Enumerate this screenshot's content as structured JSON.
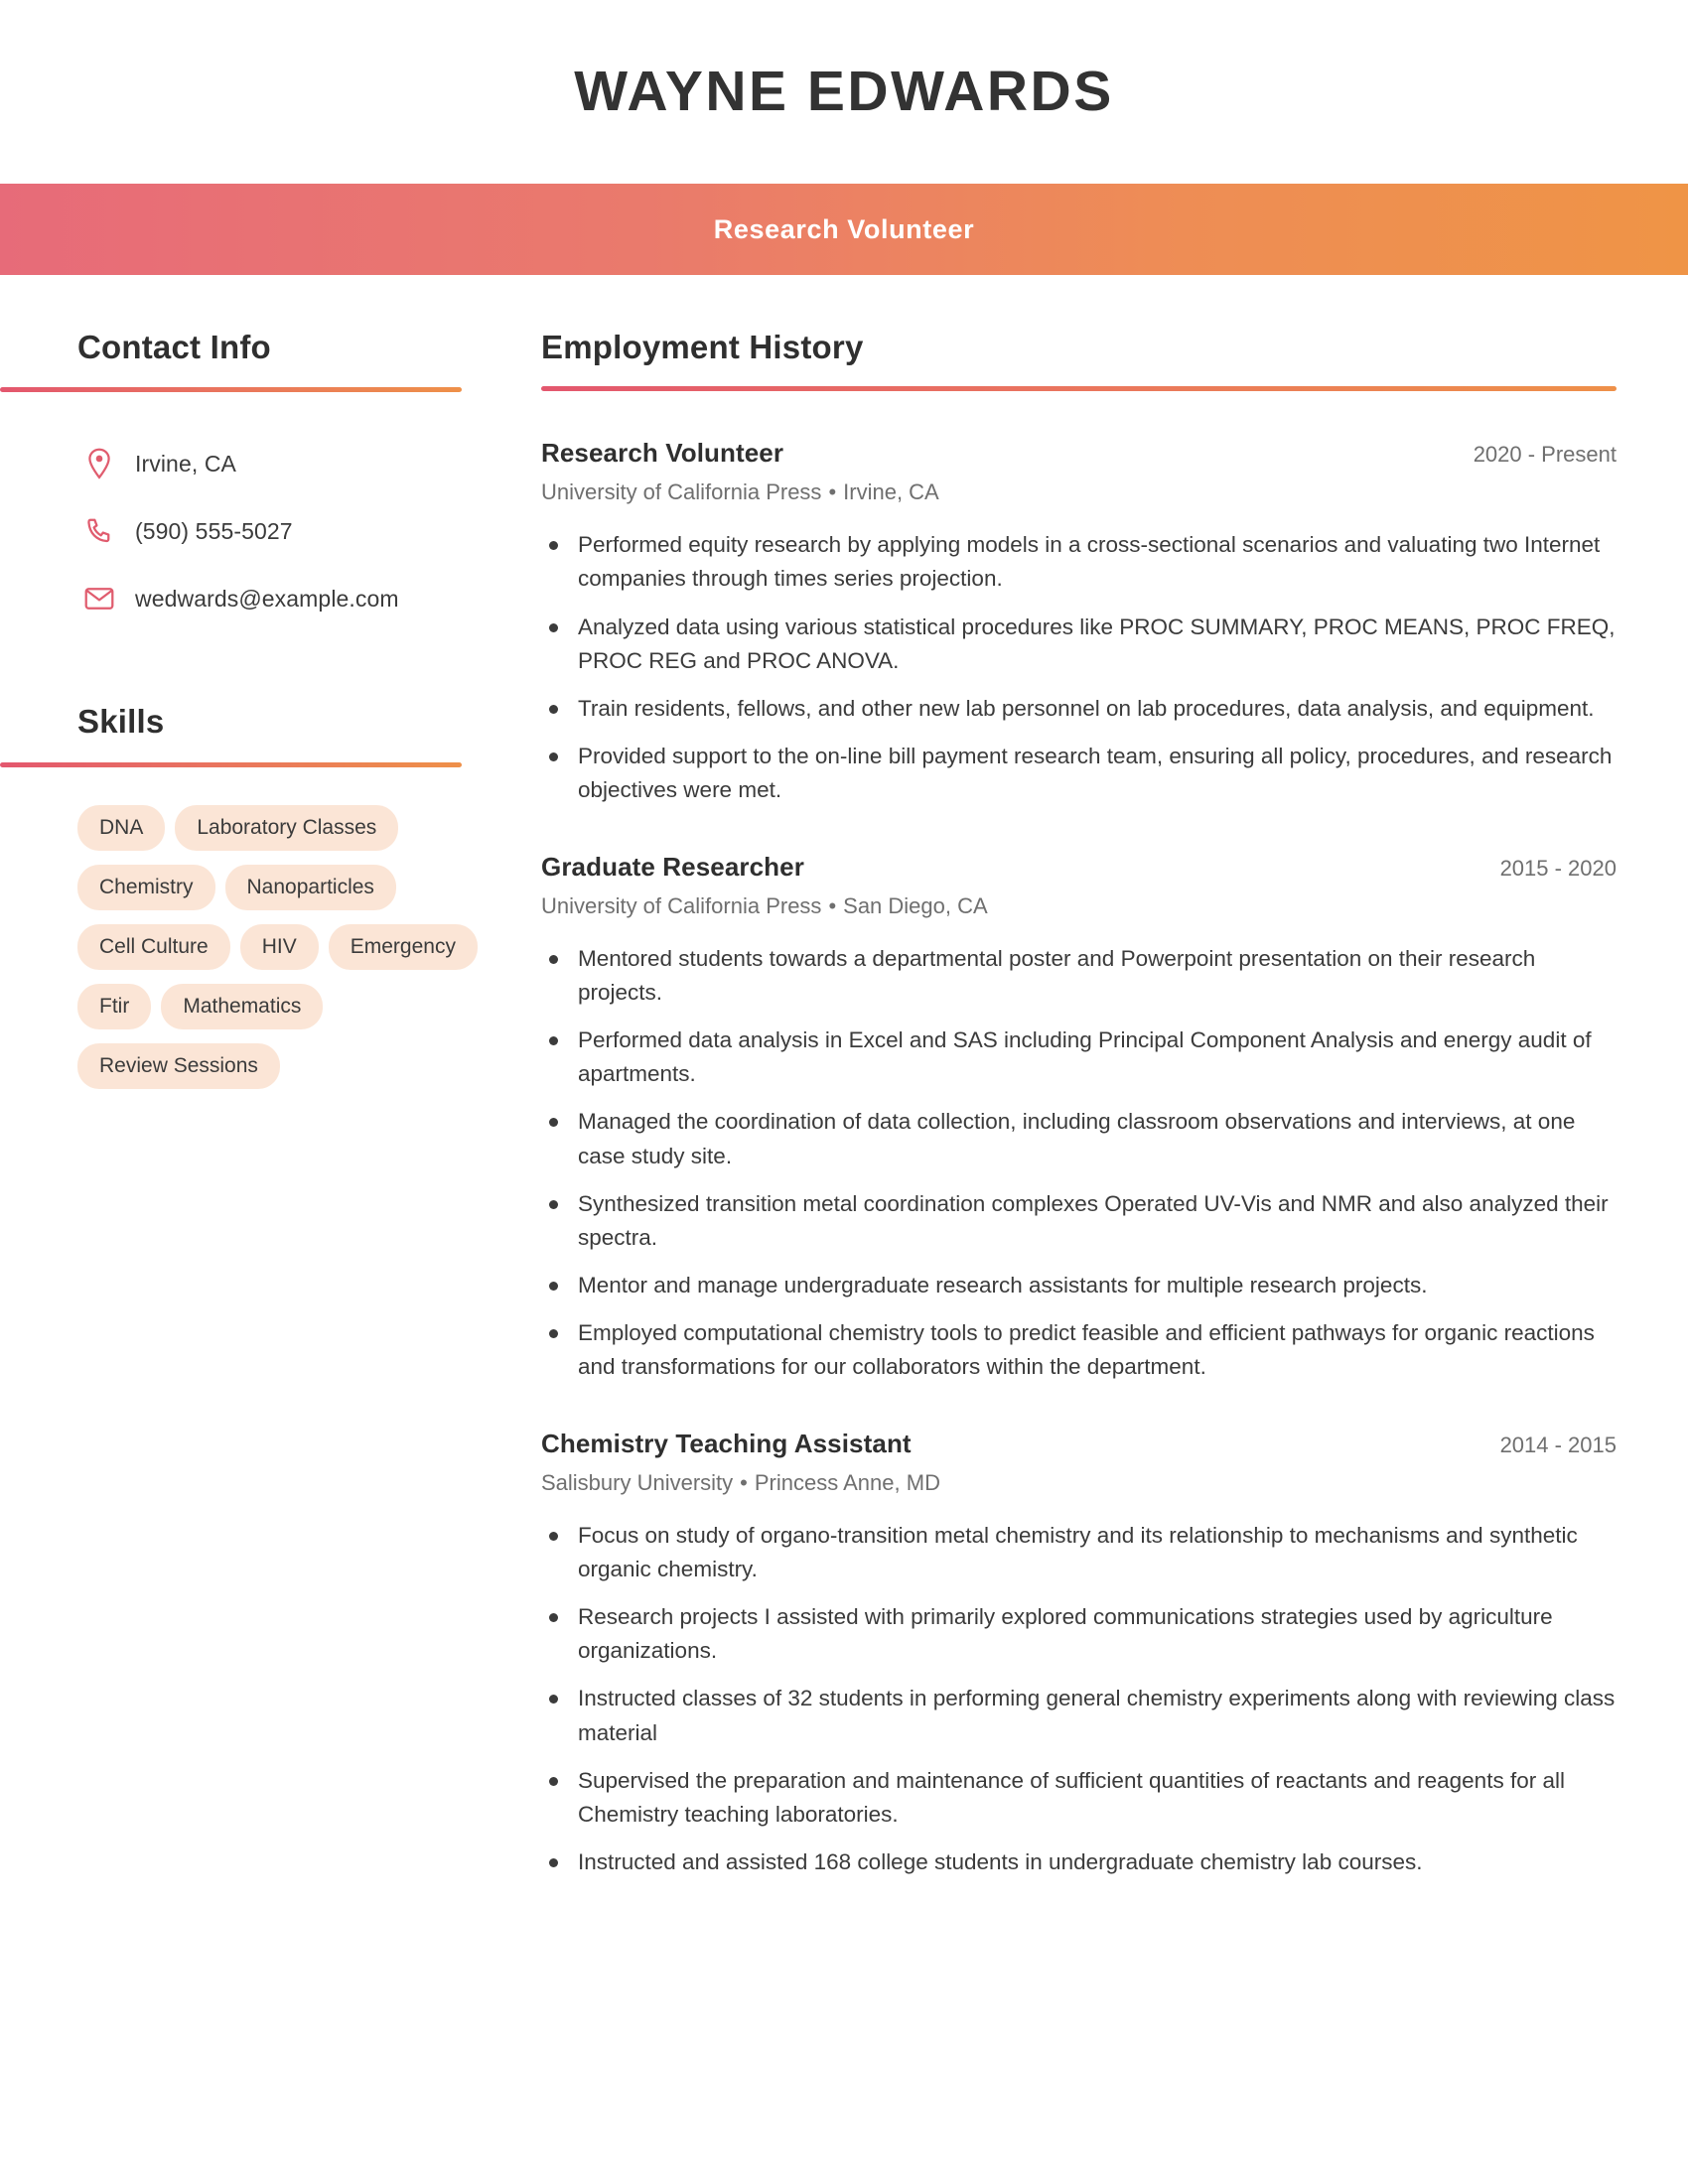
{
  "header": {
    "name": "WAYNE EDWARDS",
    "title": "Research Volunteer",
    "gradient_start": "#e76b79",
    "gradient_end": "#ef9446"
  },
  "sidebar": {
    "contact": {
      "heading": "Contact Info",
      "items": [
        {
          "icon": "location-pin-icon",
          "text": "Irvine, CA"
        },
        {
          "icon": "phone-icon",
          "text": "(590) 555-5027"
        },
        {
          "icon": "envelope-icon",
          "text": "wedwards@example.com"
        }
      ]
    },
    "skills": {
      "heading": "Skills",
      "tag_color": "#fbe5d6",
      "items": [
        "DNA",
        "Laboratory Classes",
        "Chemistry",
        "Nanoparticles",
        "Cell Culture",
        "HIV",
        "Emergency",
        "Ftir",
        "Mathematics",
        "Review Sessions"
      ]
    }
  },
  "main": {
    "heading": "Employment History",
    "jobs": [
      {
        "title": "Research Volunteer",
        "dates": "2020 - Present",
        "company": "University of California Press",
        "location": "Irvine, CA",
        "bullets": [
          "Performed equity research by applying models in a cross-sectional scenarios and valuating two Internet companies through times series projection.",
          "Analyzed data using various statistical procedures like PROC SUMMARY, PROC MEANS, PROC FREQ, PROC REG and PROC ANOVA.",
          "Train residents, fellows, and other new lab personnel on lab procedures, data analysis, and equipment.",
          "Provided support to the on-line bill payment research team, ensuring all policy, procedures, and research objectives were met."
        ]
      },
      {
        "title": "Graduate Researcher",
        "dates": "2015 - 2020",
        "company": "University of California Press",
        "location": "San Diego, CA",
        "bullets": [
          "Mentored students towards a departmental poster and Powerpoint presentation on their research projects.",
          "Performed data analysis in Excel and SAS including Principal Component Analysis and energy audit of apartments.",
          "Managed the coordination of data collection, including classroom observations and interviews, at one case study site.",
          "Synthesized transition metal coordination complexes Operated UV-Vis and NMR and also analyzed their spectra.",
          "Mentor and manage undergraduate research assistants for multiple research projects.",
          "Employed computational chemistry tools to predict feasible and efficient pathways for organic reactions and transformations for our collaborators within the department."
        ]
      },
      {
        "title": "Chemistry Teaching Assistant",
        "dates": "2014 - 2015",
        "company": "Salisbury University",
        "location": "Princess Anne, MD",
        "bullets": [
          "Focus on study of organo-transition metal chemistry and its relationship to mechanisms and synthetic organic chemistry.",
          "Research projects I assisted with primarily explored communications strategies used by agriculture organizations.",
          "Instructed classes of 32 students in performing general chemistry experiments along with reviewing class material",
          "Supervised the preparation and maintenance of sufficient quantities of reactants and reagents for all Chemistry teaching laboratories.",
          "Instructed and assisted 168 college students in undergraduate chemistry lab courses."
        ]
      }
    ],
    "separator": "•"
  }
}
